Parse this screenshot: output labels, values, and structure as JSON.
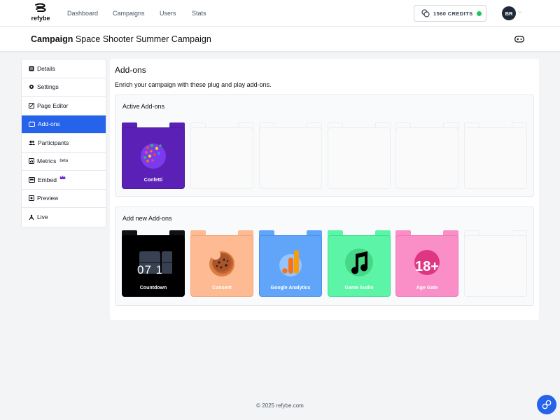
{
  "brand": {
    "name": "refybe"
  },
  "nav": {
    "items": [
      {
        "label": "Dashboard"
      },
      {
        "label": "Campaigns"
      },
      {
        "label": "Users"
      },
      {
        "label": "Stats"
      }
    ]
  },
  "credits": {
    "label": "1560 CREDITS",
    "status_color": "#22c55e"
  },
  "user": {
    "initials": "BR"
  },
  "campaign": {
    "prefix": "Campaign",
    "name": "Space Shooter Summer Campaign"
  },
  "sidebar": {
    "items": [
      {
        "label": "Details",
        "icon": "details-icon"
      },
      {
        "label": "Settings",
        "icon": "gear-icon"
      },
      {
        "label": "Page Editor",
        "icon": "edit-icon"
      },
      {
        "label": "Add-ons",
        "icon": "puzzle-icon",
        "active": true
      },
      {
        "label": "Participants",
        "icon": "users-icon"
      },
      {
        "label": "Metrics",
        "badge": "beta",
        "icon": "chart-icon"
      },
      {
        "label": "Embed",
        "icon": "embed-icon",
        "crown": true
      },
      {
        "label": "Preview",
        "icon": "preview-icon"
      },
      {
        "label": "Live",
        "icon": "live-icon"
      }
    ]
  },
  "addons": {
    "title": "Add-ons",
    "description": "Enrich your campaign with these plug and play add-ons.",
    "active_title": "Active Add-ons",
    "new_title": "Add new Add-ons",
    "active": [
      {
        "name": "Confetti",
        "color": "#5b21b6",
        "icon": "confetti-icon"
      }
    ],
    "available": [
      {
        "name": "Countdown",
        "color": "#000000",
        "icon": "countdown-icon",
        "digits": "07 1"
      },
      {
        "name": "Consent",
        "color": "#fdba93",
        "icon": "cookie-icon"
      },
      {
        "name": "Google Analytics",
        "color": "#60a5fa",
        "icon": "analytics-icon"
      },
      {
        "name": "Game Audio",
        "color": "#5cf5a8",
        "icon": "music-note-icon"
      },
      {
        "name": "Age Gate",
        "color": "#f98fc6",
        "icon": "age-18-icon",
        "badge": "18+"
      }
    ]
  },
  "footer": {
    "text": "© 2025 refybe.com"
  }
}
